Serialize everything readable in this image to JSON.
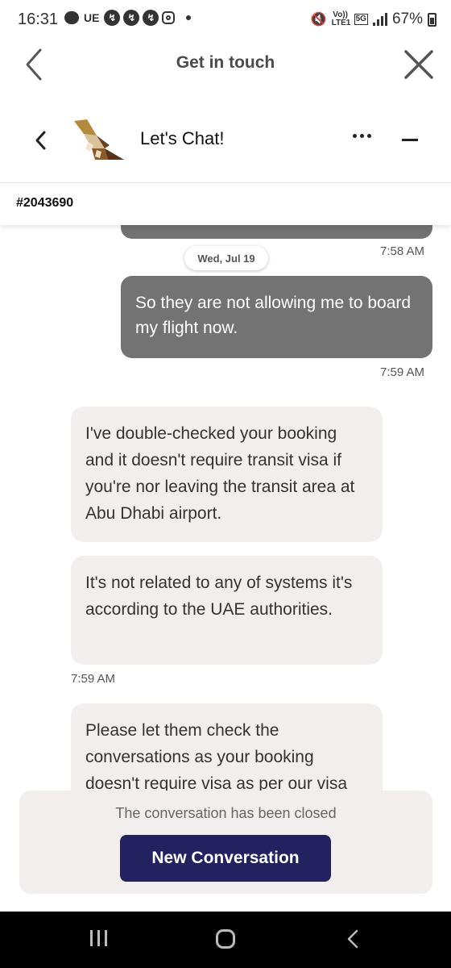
{
  "status_bar": {
    "time": "16:31",
    "ue_label": "UE",
    "volte_label": "Vo)) LTE1",
    "network_label": "5G",
    "battery": "67%"
  },
  "header": {
    "title": "Get in touch",
    "back_icon": "chevron-left-icon",
    "close_icon": "close-icon"
  },
  "chat_header": {
    "title": "Let's Chat!",
    "back_icon": "chevron-left-icon",
    "more_icon": "more-horizontal-icon",
    "minimize_icon": "minimize-icon",
    "ticket_id": "#2043690"
  },
  "messages": {
    "prev_time": "7:58 AM",
    "date_separator": "Wed, Jul 19",
    "out_1": {
      "text": "So they are not allowing me to board my flight now.",
      "time": "7:59 AM"
    },
    "in_1": {
      "text": "I've double-checked your booking and it doesn't require transit visa if you're nor leaving the transit area at Abu Dhabi airport."
    },
    "in_2": {
      "text": "It's not related to any of systems it's according to the UAE authorities.",
      "time": "7:59 AM"
    },
    "in_3": {
      "text": "Please let them check the conversations as your booking doesn't require visa as per our visa"
    }
  },
  "closed_banner": {
    "text": "The conversation has been closed",
    "button_label": "New Conversation"
  },
  "colors": {
    "outgoing_bubble": "#737373",
    "incoming_bubble": "#f2eeee",
    "primary_button": "#23215f"
  }
}
